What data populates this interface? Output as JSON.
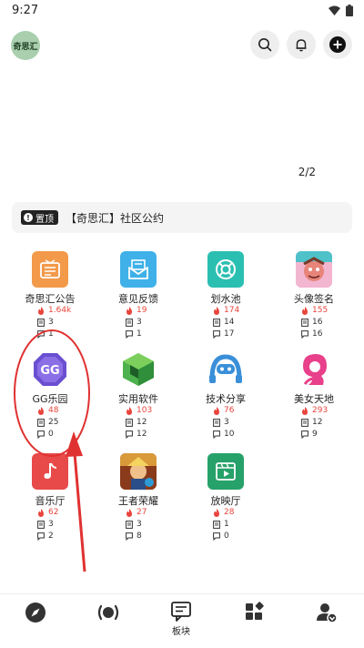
{
  "status": {
    "time": "9:27"
  },
  "header": {
    "avatar_text": "奇思汇"
  },
  "banner": {
    "pager": "2/2"
  },
  "notice": {
    "tag": "置顶",
    "title": "【奇思汇】社区公约"
  },
  "boards": [
    {
      "name": "奇思汇公告",
      "hot": "1.64k",
      "posts": "3",
      "comments": "1",
      "icon": "notice-board-icon",
      "color": "#f29a4a"
    },
    {
      "name": "意见反馈",
      "hot": "19",
      "posts": "3",
      "comments": "1",
      "icon": "mail-icon",
      "color": "#3fb1e8"
    },
    {
      "name": "划水池",
      "hot": "174",
      "posts": "14",
      "comments": "17",
      "icon": "lifebuoy-icon",
      "color": "#2bbfb2"
    },
    {
      "name": "头像签名",
      "hot": "155",
      "posts": "16",
      "comments": "16",
      "icon": "avatar-art-icon",
      "color": "#f3b6d0"
    },
    {
      "name": "GG乐园",
      "hot": "48",
      "posts": "25",
      "comments": "0",
      "icon": "gg-logo-icon",
      "color": "#6a4fd1"
    },
    {
      "name": "实用软件",
      "hot": "103",
      "posts": "12",
      "comments": "12",
      "icon": "cube-icon",
      "color": "#4db24d"
    },
    {
      "name": "技术分享",
      "hot": "76",
      "posts": "3",
      "comments": "10",
      "icon": "robot-icon",
      "color": "#3b8fd9"
    },
    {
      "name": "美女天地",
      "hot": "293",
      "posts": "12",
      "comments": "9",
      "icon": "woman-silhouette-icon",
      "color": "#e8408a"
    },
    {
      "name": "音乐厅",
      "hot": "62",
      "posts": "3",
      "comments": "2",
      "icon": "music-note-icon",
      "color": "#e84a4a"
    },
    {
      "name": "王者荣耀",
      "hot": "27",
      "posts": "3",
      "comments": "8",
      "icon": "game-art-icon",
      "color": "#c7782c"
    },
    {
      "name": "放映厅",
      "hot": "28",
      "posts": "1",
      "comments": "0",
      "icon": "video-icon",
      "color": "#27a16a"
    }
  ],
  "nav": {
    "boards_label": "板块"
  },
  "colors": {
    "accent": "#e8453c",
    "annotation": "#e03131"
  }
}
